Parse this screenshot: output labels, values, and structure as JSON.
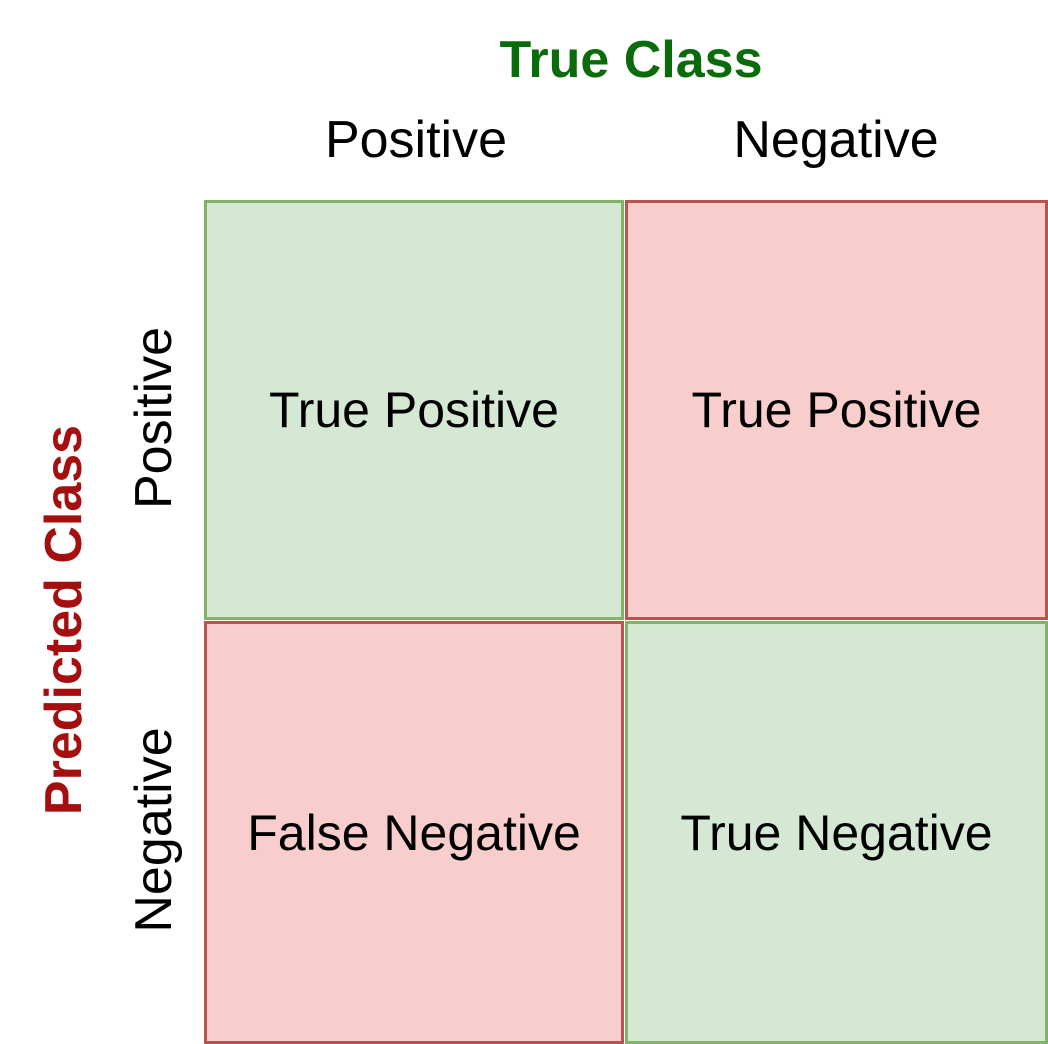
{
  "true_class": {
    "title": "True Class",
    "columns": [
      "Positive",
      "Negative"
    ]
  },
  "predicted_class": {
    "title": "Predicted Class",
    "rows": [
      "Positive",
      "Negative"
    ]
  },
  "matrix": {
    "cells": [
      [
        "True Positive",
        "True Positive"
      ],
      [
        "False Negative",
        "True Negative"
      ]
    ]
  },
  "colors": {
    "true_class_title": "#0a6b0a",
    "predicted_class_title": "#a50f0f",
    "correct_fill": "#d5e8d4",
    "correct_border": "#82b366",
    "incorrect_fill": "#f8cecc",
    "incorrect_border": "#b85450"
  }
}
